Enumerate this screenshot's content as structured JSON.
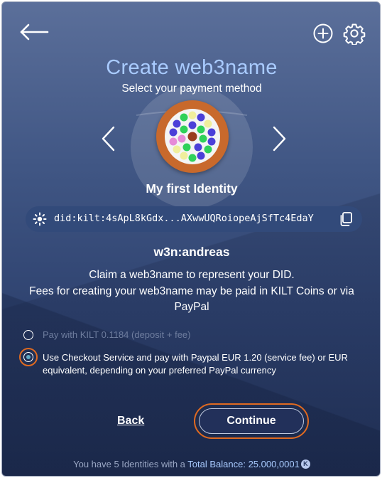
{
  "header": {
    "back_icon": "arrow-left-icon",
    "add_icon": "plus-circle-icon",
    "settings_icon": "gear-icon"
  },
  "title": "Create web3name",
  "subtitle": "Select your payment method",
  "identity": {
    "name": "My first Identity",
    "did": "did:kilt:4sApL8kGdx...AXwwUQRoiopeAjSfTc4EdaY",
    "copy_icon": "copy-icon",
    "did_icon": "sun-icon"
  },
  "web3name": "w3n:andreas",
  "description": {
    "line1": "Claim a web3name to represent your DID.",
    "line2": "Fees for creating your web3name may be paid in KILT Coins or via PayPal"
  },
  "payment_options": [
    {
      "label": "Pay with KILT 0.1184 (deposit + fee)",
      "selected": false,
      "disabled": true
    },
    {
      "label": "Use Checkout Service and pay with Paypal EUR 1.20 (service fee) or EUR equivalent, depending on your preferred PayPal currency",
      "selected": true,
      "disabled": false
    }
  ],
  "buttons": {
    "back": "Back",
    "continue": "Continue"
  },
  "footer": {
    "prefix": "You have 5 Identities with a",
    "balance_label": "Total Balance: 25.000,0001",
    "coin_glyph": "K"
  },
  "colors": {
    "accent_orange": "#e06a20",
    "title_blue": "#a9cbff",
    "background": "#405684"
  }
}
